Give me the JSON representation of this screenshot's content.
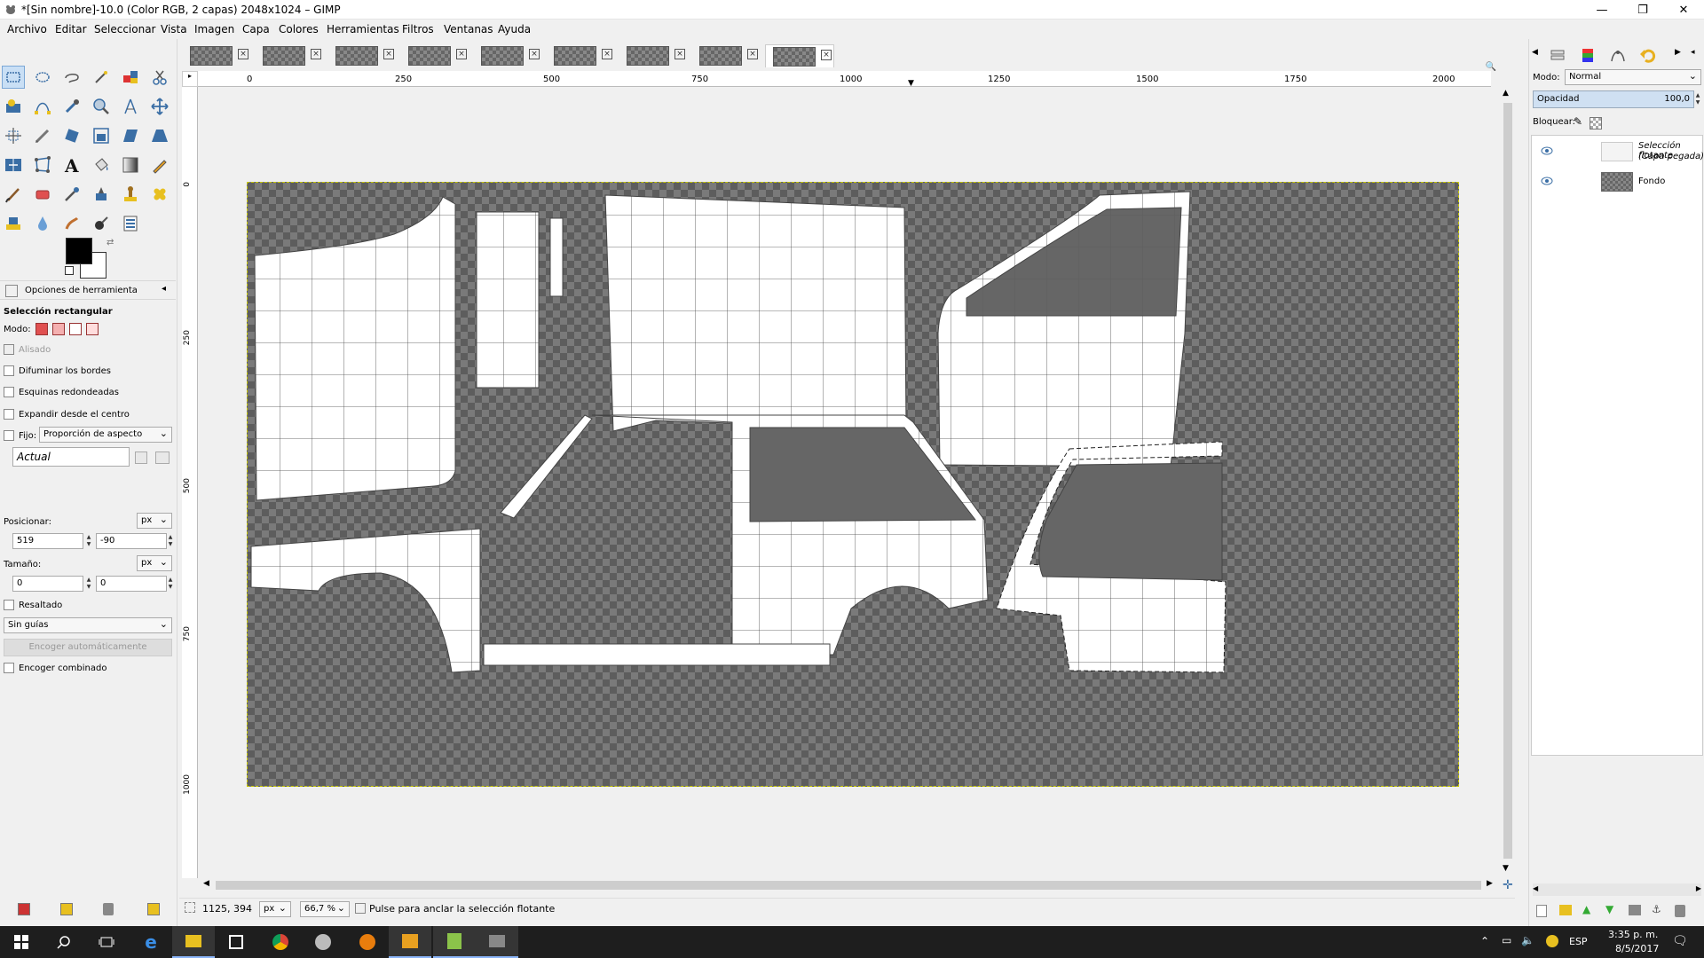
{
  "window": {
    "title": "*[Sin nombre]-10.0 (Color RGB, 2 capas) 2048x1024 – GIMP",
    "minimize": "—",
    "maximize": "❐",
    "close": "✕"
  },
  "menubar": [
    "Archivo",
    "Editar",
    "Seleccionar",
    "Vista",
    "Imagen",
    "Capa",
    "Colores",
    "Herramientas",
    "Filtros",
    "Ventanas",
    "Ayuda"
  ],
  "tool_options": {
    "panel_title": "Opciones de herramienta",
    "tool_name": "Selección rectangular",
    "mode_label": "Modo:",
    "antialias": "Alisado",
    "feather": "Difuminar los bordes",
    "rounded": "Esquinas redondeadas",
    "expand_center": "Expandir desde el centro",
    "fixed": "Fijo:",
    "fixed_value": "Proporción de aspecto",
    "current": "Actual",
    "position_label": "Posicionar:",
    "position_unit": "px",
    "pos_x": "519",
    "pos_y": "-90",
    "size_label": "Tamaño:",
    "size_unit": "px",
    "size_w": "0",
    "size_h": "0",
    "highlight": "Resaltado",
    "guides": "Sin guías",
    "auto_shrink": "Encoger automáticamente",
    "shrink_merged": "Encoger combinado"
  },
  "ruler": {
    "h": [
      "0",
      "250",
      "500",
      "750",
      "1000",
      "1250",
      "1500",
      "1750",
      "2000"
    ],
    "v": [
      "0",
      "250",
      "500",
      "750",
      "1000"
    ]
  },
  "status": {
    "coords": "1125, 394",
    "unit": "px",
    "zoom": "66,7 %",
    "message": "Pulse para anclar la selección flotante"
  },
  "layers": {
    "mode_label": "Modo:",
    "mode_value": "Normal",
    "opacity_label": "Opacidad",
    "opacity_value": "100,0",
    "lock_label": "Bloquear:",
    "items": [
      {
        "name": "Selección flotante",
        "sub": "(Capa pegada)"
      },
      {
        "name": "Fondo",
        "sub": ""
      }
    ]
  },
  "taskbar": {
    "lang": "ESP",
    "time": "3:35 p. m.",
    "date": "8/5/2017"
  },
  "colors": {
    "foreground": "#000000",
    "background": "#ffffff",
    "selection_outline": "#c8c800"
  }
}
